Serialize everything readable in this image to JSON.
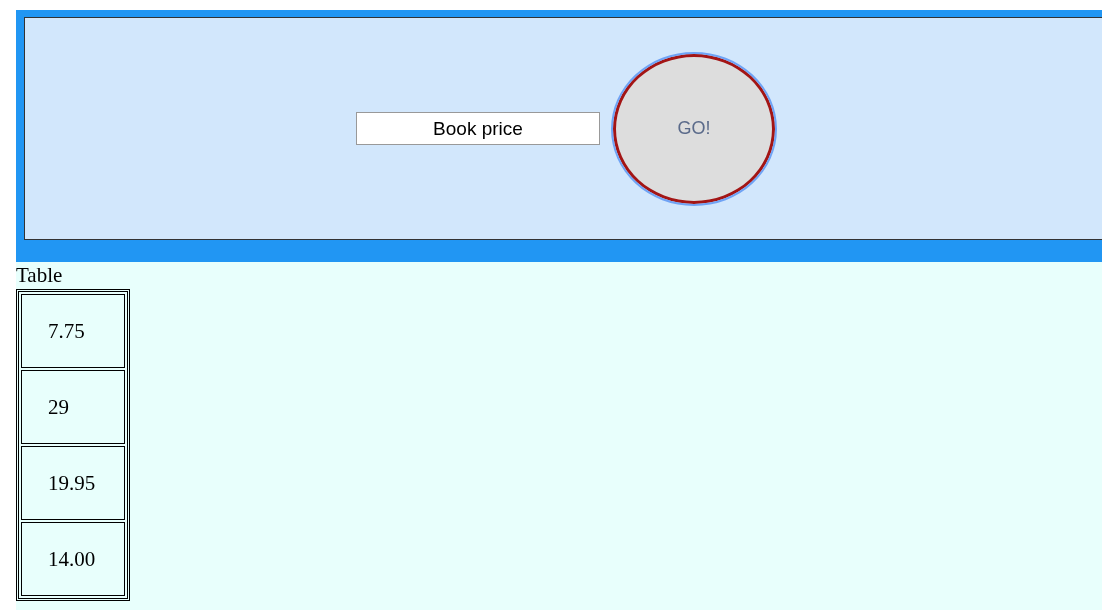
{
  "search": {
    "value": "Book price"
  },
  "go_button": {
    "label": "GO!",
    "focused": true
  },
  "table": {
    "caption": "Table",
    "rows": [
      {
        "cell": "7.75"
      },
      {
        "cell": "29"
      },
      {
        "cell": "19.95"
      },
      {
        "cell": "14.00"
      }
    ]
  }
}
